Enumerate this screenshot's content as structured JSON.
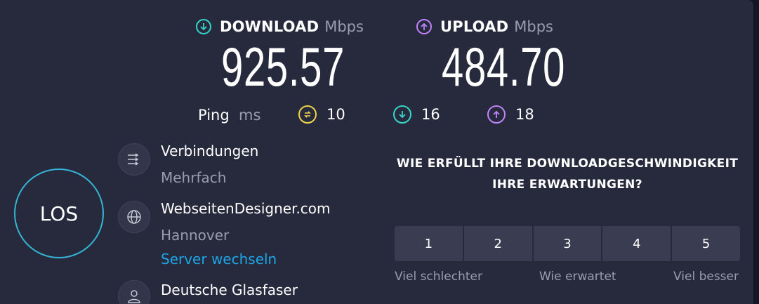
{
  "download": {
    "label": "DOWNLOAD",
    "unit": "Mbps",
    "value": "925.57",
    "color": "#35d6c8"
  },
  "upload": {
    "label": "UPLOAD",
    "unit": "Mbps",
    "value": "484.70",
    "color": "#c084fc"
  },
  "ping": {
    "label": "Ping",
    "unit": "ms",
    "idle": "10",
    "down": "16",
    "up": "18",
    "idle_color": "#f0d44c"
  },
  "go_button": "LOS",
  "connections": {
    "title": "Verbindungen",
    "value": "Mehrfach",
    "icon": "connections-icon"
  },
  "server": {
    "title": "WebseitenDesigner.com",
    "location": "Hannover",
    "change_link": "Server wechseln",
    "icon": "globe-icon"
  },
  "provider": {
    "title": "Deutsche Glasfaser",
    "icon": "user-icon"
  },
  "survey": {
    "question": "WIE ERFÜLLT IHRE DOWNLOADGESCHWINDIGKEIT IHRE ERWARTUNGEN?",
    "options": [
      "1",
      "2",
      "3",
      "4",
      "5"
    ],
    "label_low": "Viel schlechter",
    "label_mid": "Wie erwartet",
    "label_high": "Viel besser"
  }
}
